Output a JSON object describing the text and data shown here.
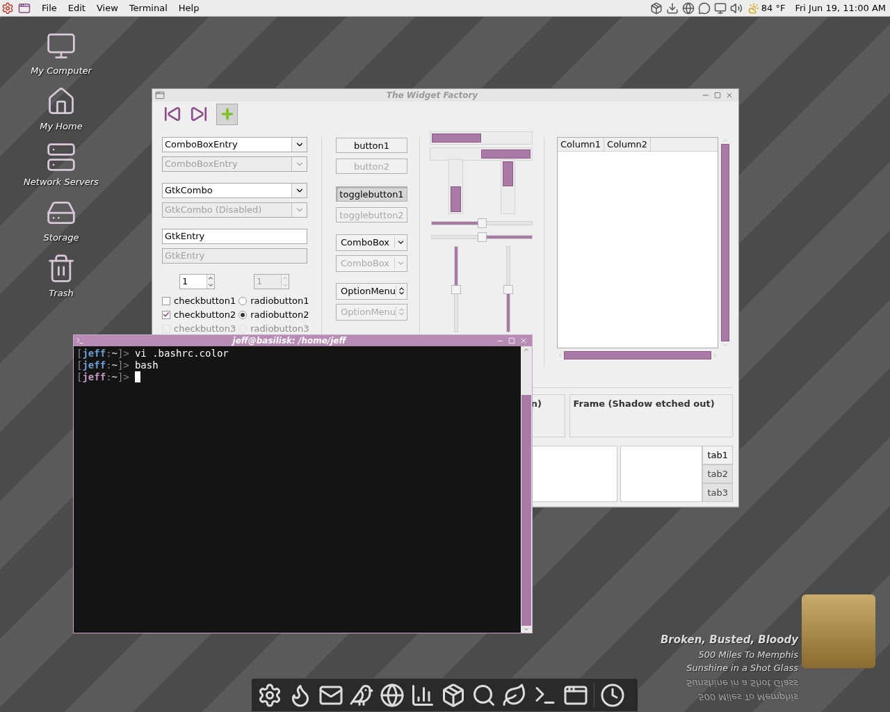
{
  "top_panel": {
    "menus": [
      "File",
      "Edit",
      "View",
      "Terminal",
      "Help"
    ],
    "weather": "84 °F",
    "clock": "Fri Jun 19, 11:00 AM"
  },
  "desktop_icons": [
    {
      "kind": "computer",
      "label": "My Computer"
    },
    {
      "kind": "home",
      "label": "My Home"
    },
    {
      "kind": "network",
      "label": "Network Servers"
    },
    {
      "kind": "storage",
      "label": "Storage"
    },
    {
      "kind": "trash",
      "label": "Trash"
    }
  ],
  "widget_factory": {
    "title": "The Widget Factory",
    "entries": [
      {
        "kind": "combo",
        "value": "ComboBoxEntry",
        "disabled": false
      },
      {
        "kind": "combo",
        "value": "ComboBoxEntry",
        "disabled": true
      },
      {
        "kind": "combo",
        "value": "GtkCombo",
        "disabled": false
      },
      {
        "kind": "combo",
        "value": "GtkCombo (Disabled)",
        "disabled": true
      },
      {
        "kind": "entry",
        "value": "GtkEntry",
        "disabled": false
      },
      {
        "kind": "entry",
        "value": "GtkEntry",
        "disabled": true
      }
    ],
    "spinners": [
      {
        "value": "1",
        "disabled": false
      },
      {
        "value": "1",
        "disabled": true
      }
    ],
    "checks": [
      {
        "label": "checkbutton1",
        "checked": false,
        "disabled": false
      },
      {
        "label": "checkbutton2",
        "checked": true,
        "disabled": false
      },
      {
        "label": "checkbutton3",
        "checked": false,
        "disabled": true
      }
    ],
    "radios": [
      {
        "label": "radiobutton1",
        "selected": false,
        "disabled": false
      },
      {
        "label": "radiobutton2",
        "selected": true,
        "disabled": false
      },
      {
        "label": "radiobutton3",
        "selected": false,
        "disabled": true
      }
    ],
    "buttons": [
      {
        "kind": "button",
        "label": "button1",
        "disabled": false
      },
      {
        "kind": "button",
        "label": "button2",
        "disabled": true
      },
      {
        "kind": "toggle",
        "label": "togglebutton1",
        "on": true,
        "disabled": false
      },
      {
        "kind": "toggle",
        "label": "togglebutton2",
        "on": false,
        "disabled": true
      },
      {
        "kind": "combo",
        "label": "ComboBox",
        "disabled": false
      },
      {
        "kind": "combo",
        "label": "ComboBox",
        "disabled": true
      },
      {
        "kind": "option",
        "label": "OptionMenu",
        "disabled": false
      },
      {
        "kind": "option",
        "label": "OptionMenu",
        "disabled": true
      }
    ],
    "progress_bars": [
      {
        "kind": "ltr",
        "level": 0.5
      },
      {
        "kind": "rtl",
        "level": 0.5
      },
      {
        "kind": "btt",
        "level": 0.5
      },
      {
        "kind": "ttb",
        "level": 0.5
      }
    ],
    "scales": [
      {
        "kind": "ltr",
        "level": 0.5
      },
      {
        "kind": "rtl",
        "level": 0.5
      },
      {
        "kind": "ttb",
        "level": 0.5
      },
      {
        "kind": "btt",
        "level": 0.5
      }
    ],
    "tree_columns": [
      "Column1",
      "Column2"
    ],
    "frames": [
      {
        "kind": "etched-in",
        "label": "n)"
      },
      {
        "kind": "etched-out",
        "label": "Frame (Shadow etched out)"
      }
    ],
    "notebooks": [
      {
        "kind": "right",
        "tabs": [
          {
            "label": "tab1",
            "selected": true
          },
          {
            "label": "tab2",
            "selected": false
          },
          {
            "label": "tab3",
            "selected": false
          }
        ]
      }
    ]
  },
  "terminal": {
    "title": "jeff@basilisk: /home/jeff",
    "lines": [
      {
        "open": "[",
        "user": "jeff",
        "color": "#6f9fd8",
        "sep": ":",
        "path": "~",
        "close": "]>",
        "command": "vi .bashrc.color",
        "cursor": false
      },
      {
        "open": "[",
        "user": "jeff",
        "color": "#6f9fd8",
        "sep": ":",
        "path": "~",
        "close": "]>",
        "command": "bash",
        "cursor": false
      },
      {
        "open": "[",
        "user": "jeff",
        "color": "#c49ac4",
        "sep": ":",
        "path": "~",
        "close": "]>",
        "cursor": true
      }
    ]
  },
  "now_playing": {
    "title": "Broken, Busted, Bloody",
    "artist": "500 Miles To Memphis",
    "album": "Sunshine in a Shot Glass",
    "reflection": {
      "artist": "500 Miles To Memphis",
      "album": "Sunshine in a Shot Glass"
    }
  }
}
